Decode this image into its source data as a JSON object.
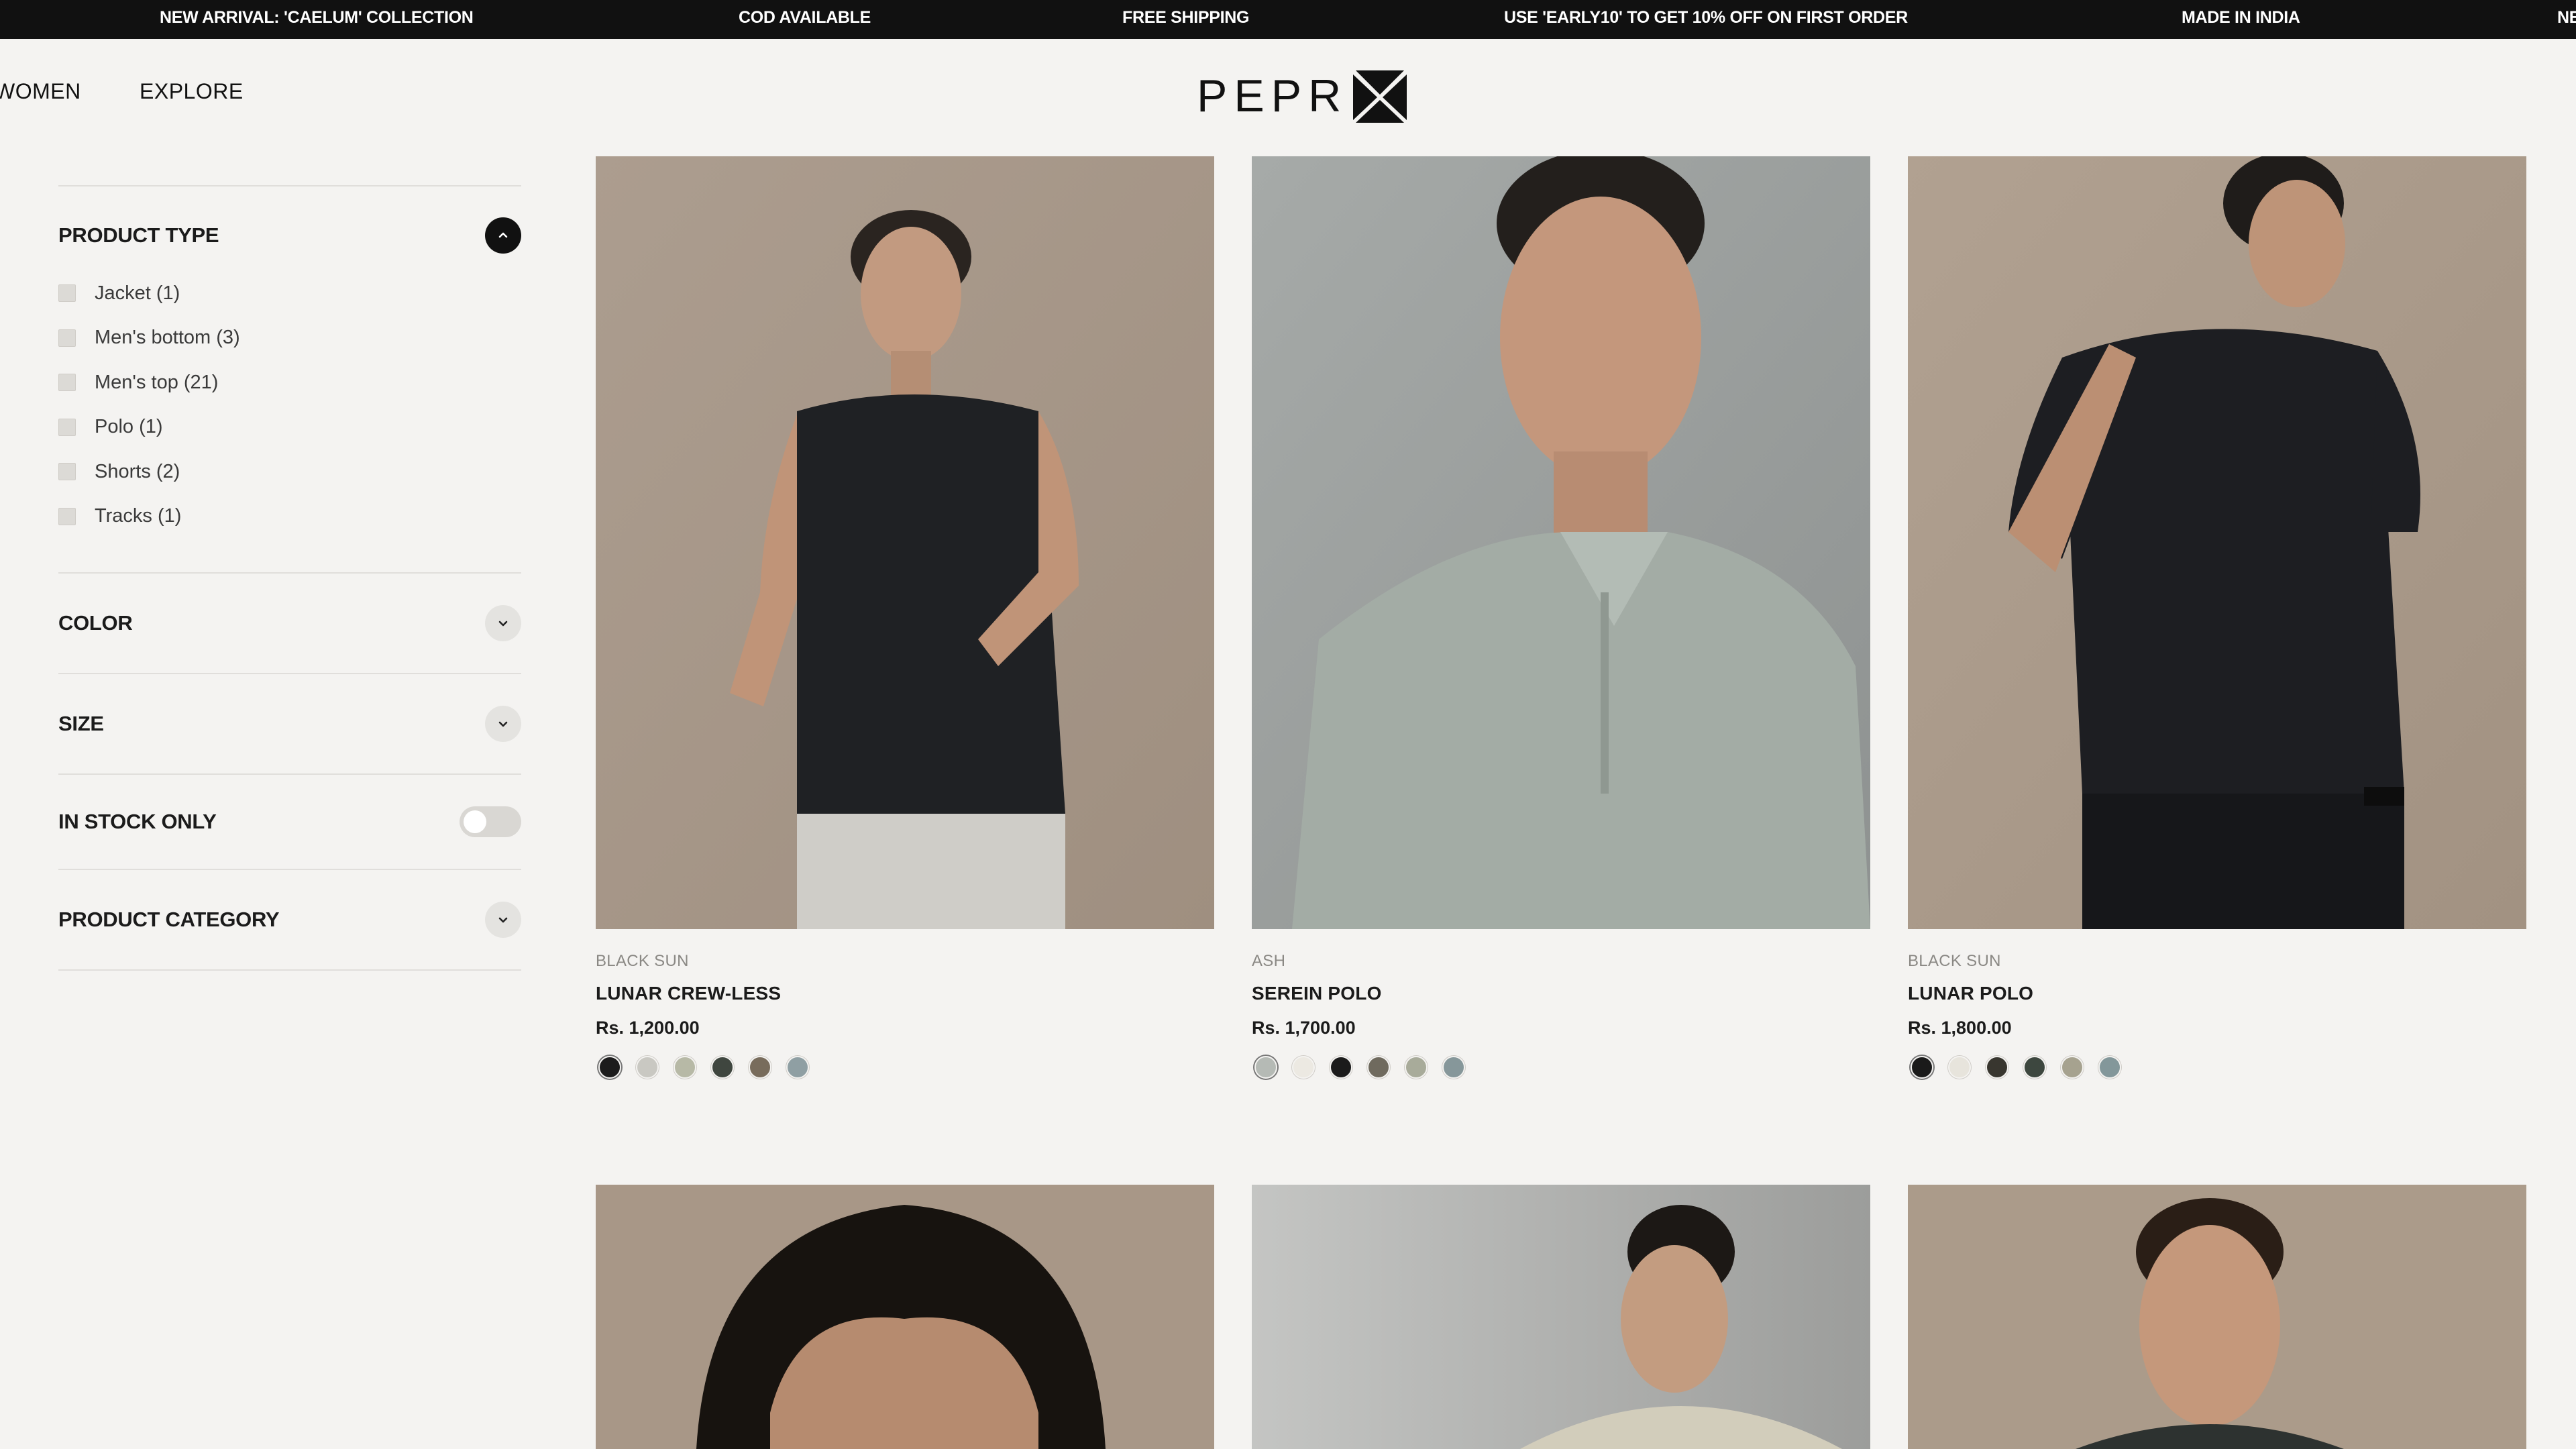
{
  "announcements": [
    "NEW ARRIVAL: 'CAELUM' COLLECTION",
    "COD AVAILABLE",
    "FREE SHIPPING",
    "USE 'EARLY10' TO GET 10% OFF ON FIRST ORDER",
    "MADE IN INDIA",
    "NE"
  ],
  "nav": {
    "women": "WOMEN",
    "explore": "EXPLORE"
  },
  "logo": {
    "text": "PEPR"
  },
  "filters": {
    "product_type": {
      "title": "PRODUCT TYPE",
      "items": [
        "Jacket (1)",
        "Men's bottom (3)",
        "Men's top (21)",
        "Polo (1)",
        "Shorts (2)",
        "Tracks (1)"
      ]
    },
    "color": {
      "title": "COLOR"
    },
    "size": {
      "title": "SIZE"
    },
    "in_stock": {
      "title": "IN STOCK ONLY",
      "enabled": false
    },
    "product_category": {
      "title": "PRODUCT CATEGORY"
    }
  },
  "products": [
    {
      "brand": "BLACK SUN",
      "name": "LUNAR CREW-LESS",
      "price": "Rs. 1,200.00",
      "swatches": [
        "#1c1c1c",
        "#c9c8c2",
        "#b7b9a6",
        "#3f463f",
        "#786c5c",
        "#8f9fa3"
      ]
    },
    {
      "brand": "ASH",
      "name": "SEREIN POLO",
      "price": "Rs. 1,700.00",
      "swatches": [
        "#b5bab5",
        "#ece9e2",
        "#1b1b1b",
        "#6f6a5e",
        "#a8ab9a",
        "#86979a"
      ]
    },
    {
      "brand": "BLACK SUN",
      "name": "LUNAR POLO",
      "price": "Rs. 1,800.00",
      "swatches": [
        "#1a1a1a",
        "#e7e4dc",
        "#38362f",
        "#3d473f",
        "#a6a28f",
        "#83979a"
      ]
    }
  ],
  "colors": {
    "announce_bg": "#111111",
    "page_bg": "#f4f3f1",
    "photo_warm": "#a89888",
    "photo_grey": "#9ea2a0"
  }
}
